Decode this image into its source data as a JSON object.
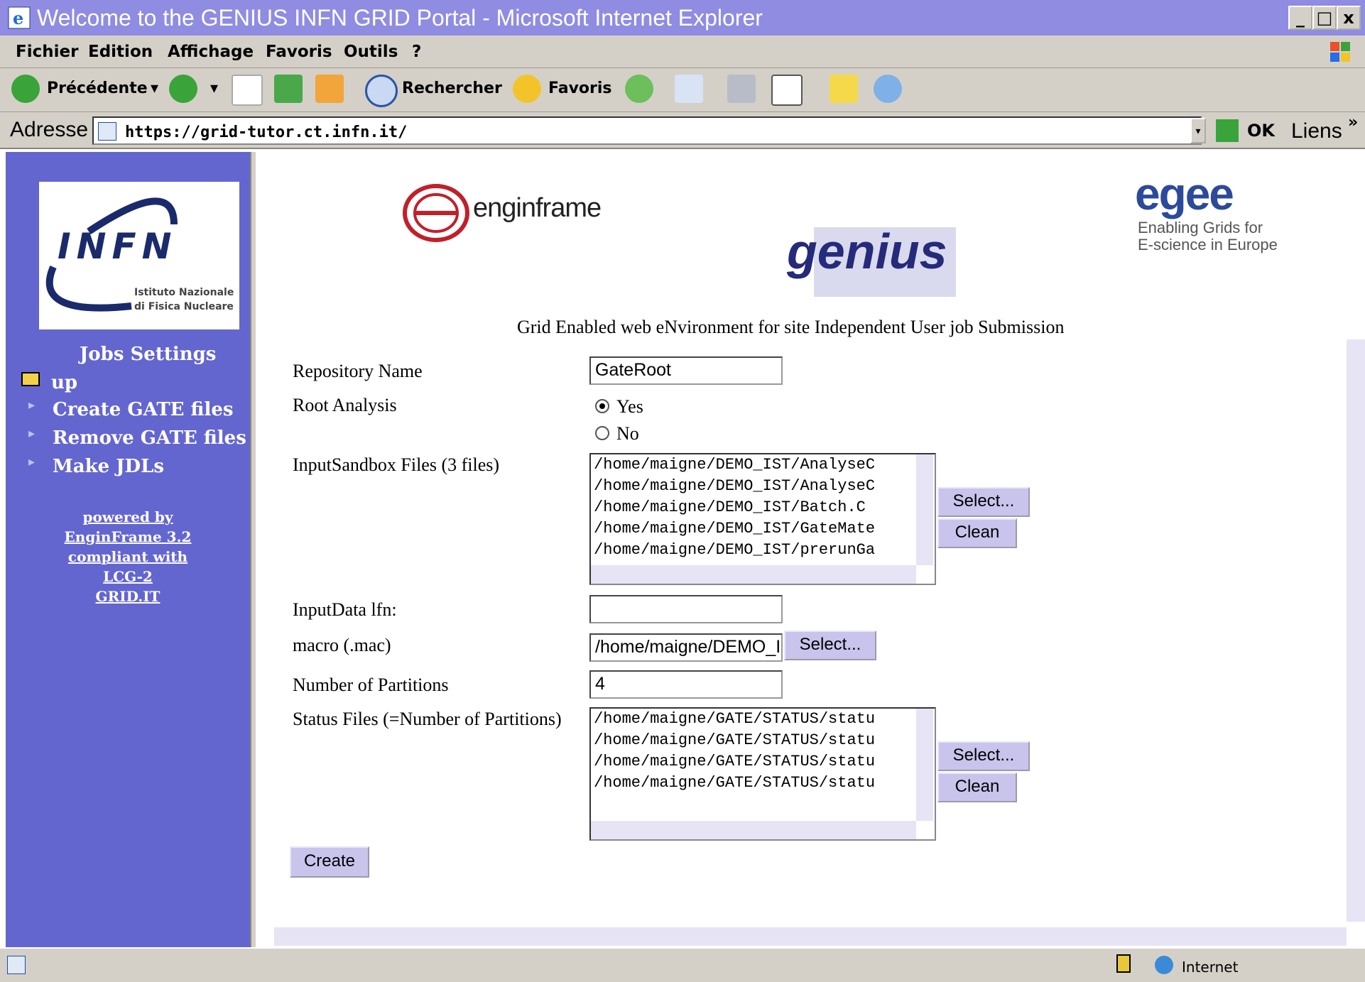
{
  "window": {
    "title": "Welcome to the GENIUS INFN GRID Portal - Microsoft Internet Explorer",
    "controls": [
      "_",
      "□",
      "x"
    ]
  },
  "menubar": [
    "Fichier",
    "Edition",
    "Affichage",
    "Favoris",
    "Outils",
    "?"
  ],
  "toolbar": {
    "back": "Précédente",
    "search": "Rechercher",
    "favorites": "Favoris"
  },
  "address": {
    "label": "Adresse",
    "url": "https://grid-tutor.ct.infn.it/",
    "go": "OK",
    "links": "Liens"
  },
  "sidebar": {
    "logo_text": "INFN",
    "logo_sub1": "Istituto Nazionale",
    "logo_sub2": "di Fisica Nucleare",
    "title": "Jobs Settings",
    "up": "up",
    "links": [
      "Create GATE files",
      "Remove GATE files",
      "Make JDLs"
    ],
    "powered": [
      "powered by",
      "EnginFrame 3.2",
      "compliant with",
      "LCG-2",
      "GRID.IT"
    ]
  },
  "header": {
    "enginframe": "enginframe",
    "genius": "genius",
    "egee": "egee",
    "egee_sub1": "Enabling Grids for",
    "egee_sub2": "E-science in Europe",
    "tagline": "Grid Enabled web eNvironment for site Independent User job Submission"
  },
  "form": {
    "repo_label": "Repository Name",
    "repo_value": "GateRoot",
    "root_label": "Root Analysis",
    "yes": "Yes",
    "no": "No",
    "inputsandbox_label": "InputSandbox Files (3 files)",
    "inputsandbox_files": [
      "/home/maigne/DEMO_IST/AnalyseC",
      "/home/maigne/DEMO_IST/AnalyseC",
      "/home/maigne/DEMO_IST/Batch.C",
      "/home/maigne/DEMO_IST/GateMate",
      "/home/maigne/DEMO_IST/prerunGa"
    ],
    "inputdata_label": "InputData lfn:",
    "inputdata_value": "",
    "macro_label": "macro (.mac)",
    "macro_value": "/home/maigne/DEMO_I",
    "partitions_label": "Number of Partitions",
    "partitions_value": "4",
    "status_label": "Status Files (=Number of Partitions)",
    "status_files": [
      "/home/maigne/GATE/STATUS/statu",
      "/home/maigne/GATE/STATUS/statu",
      "/home/maigne/GATE/STATUS/statu",
      "/home/maigne/GATE/STATUS/statu"
    ],
    "select": "Select...",
    "clean": "Clean",
    "create": "Create"
  },
  "status": {
    "zone": "Internet"
  }
}
